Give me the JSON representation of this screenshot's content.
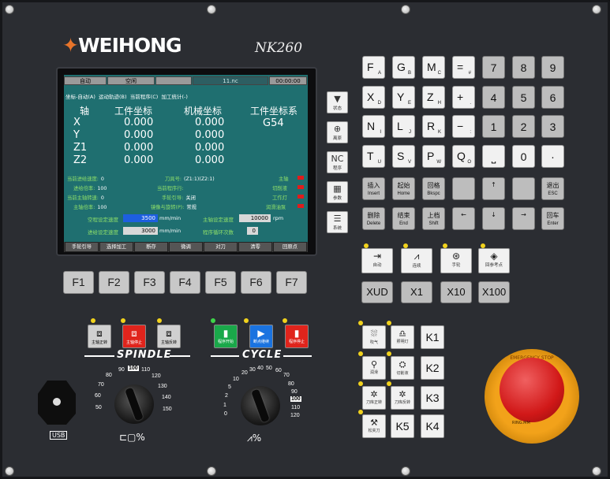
{
  "brand": {
    "name": "WEIHONG",
    "model": "NK260"
  },
  "screen": {
    "status_bar": [
      "自动",
      "空闲",
      "",
      "11.nc",
      "00:00:00"
    ],
    "menu": [
      "坐标-自动(A)",
      "运动轨迹(B)",
      "当前程序(C)",
      "加工统计(-)"
    ],
    "coord_headers": {
      "axis": "轴",
      "work": "工件坐标",
      "machine": "机械坐标",
      "wcs_title": "工件坐标系"
    },
    "wcs": "G54",
    "axes": [
      {
        "name": "X",
        "work": "0.000",
        "machine": "0.000"
      },
      {
        "name": "Y",
        "work": "0.000",
        "machine": "0.000"
      },
      {
        "name": "Z1",
        "work": "0.000",
        "machine": "0.000"
      },
      {
        "name": "Z2",
        "work": "0.000",
        "machine": "0.000"
      }
    ],
    "status_left": [
      {
        "label": "当前进给速度:",
        "value": "0"
      },
      {
        "label": "进给倍率:",
        "value": "100"
      },
      {
        "label": "当前主轴转速:",
        "value": "0"
      },
      {
        "label": "主轴倍率:",
        "value": "100"
      }
    ],
    "status_mid": [
      {
        "label": "刀具号:",
        "value": "(Z1:1)(Z2:1)"
      },
      {
        "label": "当前程序行:",
        "value": ""
      },
      {
        "label": "手轮引导:",
        "value": "关闭"
      },
      {
        "label": "镜像与旋转(P):",
        "value": "常规"
      }
    ],
    "status_right": [
      "主轴",
      "切削液",
      "工作灯",
      "润滑油泵"
    ],
    "settings": {
      "idle_speed_label": "空程设定速度",
      "idle_speed": "3500",
      "feed_speed_label": "进给设定速度",
      "feed_speed": "3000",
      "speed_unit": "mm/min",
      "spindle_set_label": "主轴设定速度",
      "spindle_set": "10000",
      "spindle_unit": "rpm",
      "cycle_count_label": "程序循环次数",
      "cycle_count": "0"
    },
    "softkeys": [
      "手轮引导",
      "选择加工",
      "断存",
      "微调",
      "对刀",
      "清零",
      "回原点"
    ]
  },
  "fkeys": [
    "F1",
    "F2",
    "F3",
    "F4",
    "F5",
    "F6",
    "F7"
  ],
  "side_buttons": [
    {
      "icon": "▼",
      "label": "状态"
    },
    {
      "icon": "⊕",
      "label": "离原"
    },
    {
      "icon": "NC",
      "label": "程序"
    },
    {
      "icon": "▦",
      "label": "参数"
    },
    {
      "icon": "☰",
      "label": "系统"
    }
  ],
  "keypad": {
    "letters": [
      {
        "main": "F",
        "sub": "A"
      },
      {
        "main": "G",
        "sub": "B"
      },
      {
        "main": "M",
        "sub": "C"
      },
      {
        "main": "=",
        "sub": "#"
      },
      {
        "main": "X",
        "sub": "D"
      },
      {
        "main": "Y",
        "sub": "E"
      },
      {
        "main": "Z",
        "sub": "H"
      },
      {
        "main": "+",
        "sub": "."
      },
      {
        "main": "N",
        "sub": "I"
      },
      {
        "main": "L",
        "sub": "J"
      },
      {
        "main": "R",
        "sub": "K"
      },
      {
        "main": "−",
        "sub": ":"
      },
      {
        "main": "T",
        "sub": "U"
      },
      {
        "main": "S",
        "sub": "V"
      },
      {
        "main": "P",
        "sub": "W"
      },
      {
        "main": "Q",
        "sub": "O"
      }
    ],
    "nums": [
      "7",
      "8",
      "9",
      "4",
      "5",
      "6",
      "1",
      "2",
      "3",
      "⎵",
      "0",
      "·"
    ],
    "func_row1": [
      {
        "cn": "插入",
        "en": "Insert"
      },
      {
        "cn": "起始",
        "en": "Home"
      },
      {
        "cn": "回格",
        "en": "Bkspc"
      },
      {
        "cn": "",
        "en": ""
      },
      {
        "cn": "↑",
        "en": ""
      },
      {
        "cn": "",
        "en": ""
      },
      {
        "cn": "退出",
        "en": "ESC"
      }
    ],
    "func_row2": [
      {
        "cn": "删除",
        "en": "Delete"
      },
      {
        "cn": "结束",
        "en": "End"
      },
      {
        "cn": "上档",
        "en": "Shift"
      },
      {
        "cn": "←",
        "en": ""
      },
      {
        "cn": "↓",
        "en": ""
      },
      {
        "cn": "→",
        "en": ""
      },
      {
        "cn": "回车",
        "en": "Enter"
      }
    ]
  },
  "modes": [
    {
      "icon": "⇥",
      "label": "自动"
    },
    {
      "icon": "⩘",
      "label": "连续"
    },
    {
      "icon": "⊛",
      "label": "手轮"
    },
    {
      "icon": "◈",
      "label": "回参考点"
    }
  ],
  "steps": [
    "XUD",
    "X1",
    "X10",
    "X100"
  ],
  "spindle": {
    "label": "SPINDLE",
    "buttons": [
      {
        "icon": "⧈",
        "label": "主轴正转",
        "color": "#d0d0d0"
      },
      {
        "icon": "⧈",
        "label": "主轴停止",
        "color": "#e0241c"
      },
      {
        "icon": "⧈",
        "label": "主轴反转",
        "color": "#d0d0d0"
      }
    ],
    "dial": [
      "50",
      "60",
      "70",
      "80",
      "90",
      "100",
      "110",
      "120",
      "130",
      "140",
      "150"
    ],
    "highlight": "100"
  },
  "cycle": {
    "label": "CYCLE",
    "buttons": [
      {
        "icon": "▮",
        "label": "程序开始",
        "color": "#1aa84a"
      },
      {
        "icon": "▶",
        "label": "断点继续",
        "color": "#1a73e0"
      },
      {
        "icon": "▮",
        "label": "程序停止",
        "color": "#e0241c"
      }
    ],
    "dial": [
      "0",
      "1",
      "2",
      "5",
      "10",
      "20",
      "30",
      "40",
      "50",
      "60",
      "70",
      "80",
      "90",
      "100",
      "110",
      "120"
    ],
    "highlight": "100"
  },
  "usb": "USB",
  "aux_buttons": [
    {
      "icon": "⛆",
      "label": "吹气"
    },
    {
      "icon": "♎",
      "label": "照明灯"
    },
    {
      "icon": "⚲",
      "label": "润滑"
    },
    {
      "icon": "⛭",
      "label": "切削液"
    },
    {
      "icon": "✲",
      "label": "刀库正转"
    },
    {
      "icon": "✲",
      "label": "刀库反转"
    },
    {
      "icon": "⚒",
      "label": "松夹刀"
    }
  ],
  "k_buttons": [
    "K1",
    "K2",
    "K3",
    "K5",
    "K4"
  ],
  "estop": {
    "text": "EMERGENCY STOP",
    "bottom": "RING.MM"
  }
}
